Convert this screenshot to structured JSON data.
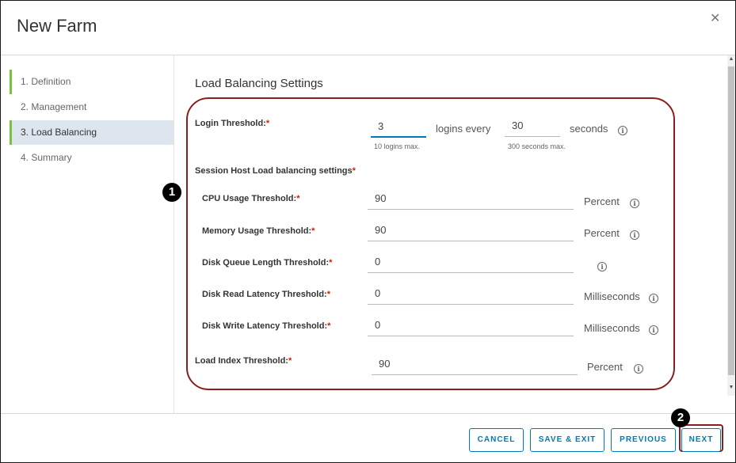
{
  "dialog": {
    "title": "New Farm",
    "close_icon": "close-icon",
    "close_glyph": "✕"
  },
  "sidebar": {
    "items": [
      {
        "label": "1. Definition",
        "state": "done"
      },
      {
        "label": "2. Management",
        "state": "default"
      },
      {
        "label": "3. Load Balancing",
        "state": "active"
      },
      {
        "label": "4. Summary",
        "state": "default"
      }
    ]
  },
  "main": {
    "section_title": "Load Balancing Settings",
    "login_threshold": {
      "label": "Login Threshold:",
      "logins_value": "3",
      "logins_hint": "10 logins max.",
      "middle_text": "logins every",
      "seconds_value": "30",
      "seconds_hint": "300 seconds max.",
      "unit": "seconds"
    },
    "session_host": {
      "label": "Session Host Load balancing settings"
    },
    "thresholds": [
      {
        "label": "CPU Usage Threshold:",
        "value": "90",
        "unit": "Percent"
      },
      {
        "label": "Memory Usage Threshold:",
        "value": "90",
        "unit": "Percent"
      },
      {
        "label": "Disk Queue Length Threshold:",
        "value": "0",
        "unit": ""
      },
      {
        "label": "Disk Read Latency Threshold:",
        "value": "0",
        "unit": "Milliseconds"
      },
      {
        "label": "Disk Write Latency Threshold:",
        "value": "0",
        "unit": "Milliseconds"
      }
    ],
    "load_index": {
      "label": "Load Index Threshold:",
      "value": "90",
      "unit": "Percent"
    },
    "required_mark": "*",
    "info_glyph": "i"
  },
  "annotations": {
    "badge1": "1",
    "badge2": "2"
  },
  "scrollbar": {
    "up_glyph": "▲",
    "down_glyph": "▼"
  },
  "footer": {
    "cancel_label": "CANCEL",
    "save_exit_label": "SAVE & EXIT",
    "previous_label": "PREVIOUS",
    "next_label": "NEXT"
  },
  "colors": {
    "accent": "#0079b8",
    "step_done": "#7cc043",
    "active_step_bg": "#dde6ee",
    "required": "#c92100",
    "annotation": "#8b1d1d"
  }
}
